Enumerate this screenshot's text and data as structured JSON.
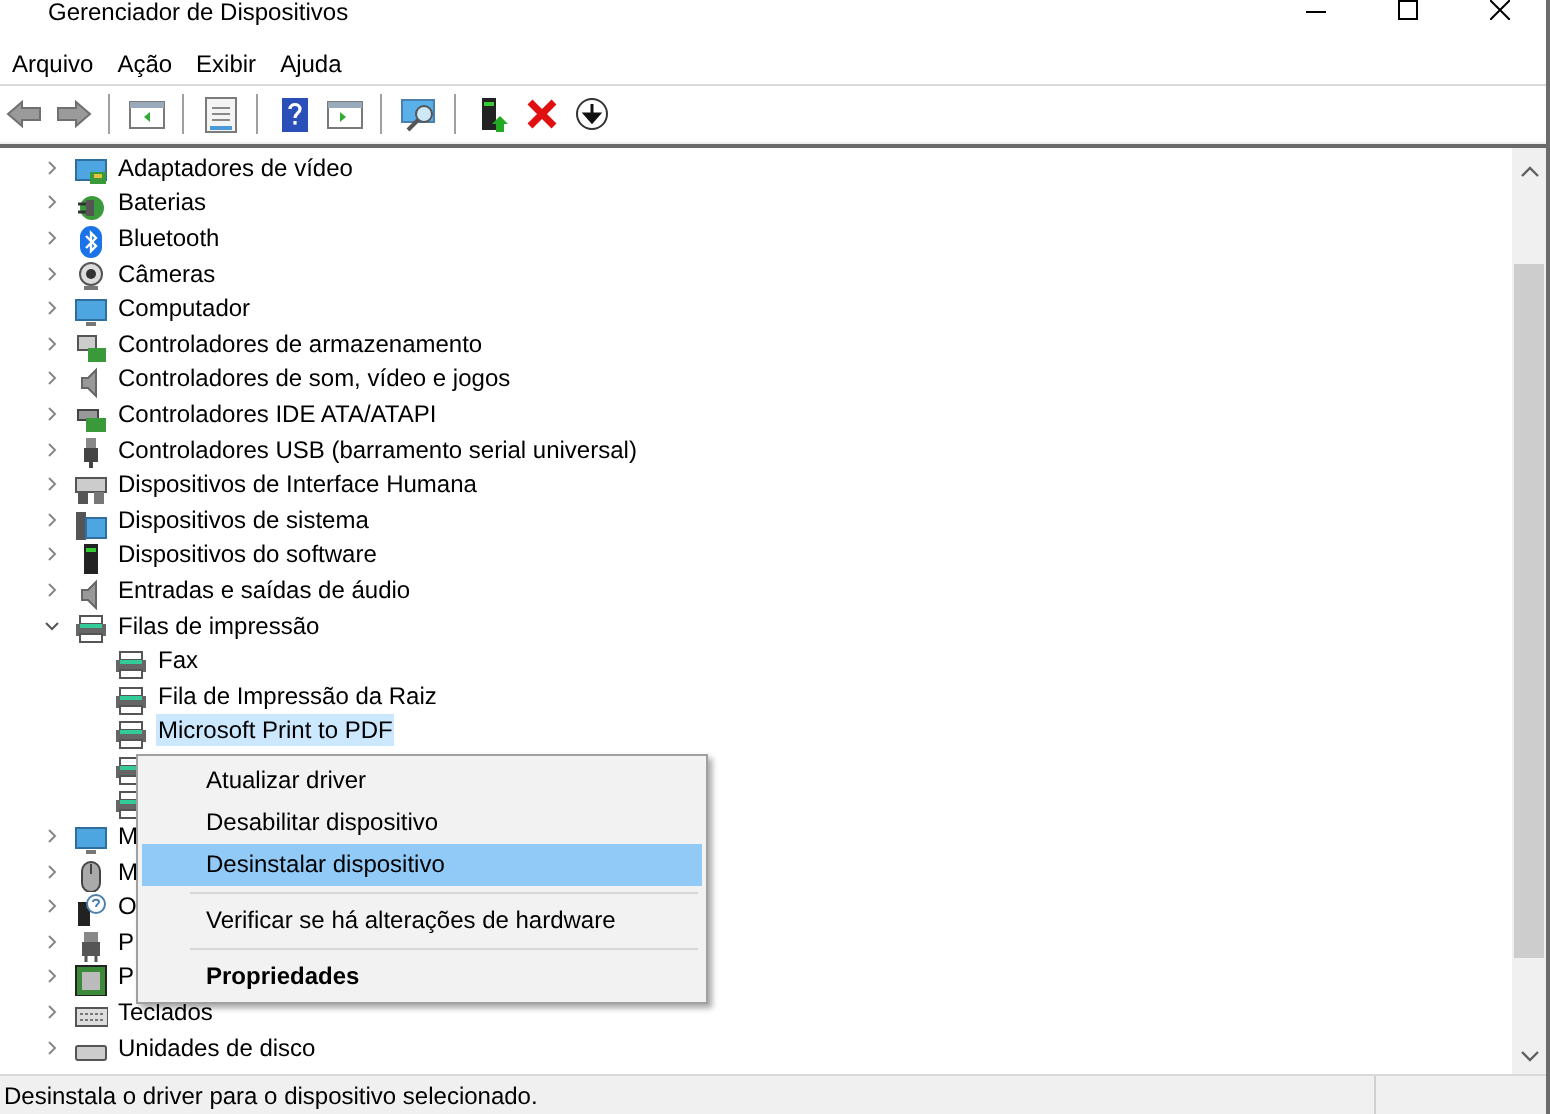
{
  "window": {
    "title": "Gerenciador de Dispositivos"
  },
  "menu": [
    "Arquivo",
    "Ação",
    "Exibir",
    "Ajuda"
  ],
  "toolbar": [
    {
      "kind": "back"
    },
    {
      "kind": "forward"
    },
    {
      "kind": "sep"
    },
    {
      "kind": "panel"
    },
    {
      "kind": "sep"
    },
    {
      "kind": "sheet"
    },
    {
      "kind": "sep"
    },
    {
      "kind": "help"
    },
    {
      "kind": "panel2"
    },
    {
      "kind": "sep"
    },
    {
      "kind": "scan"
    },
    {
      "kind": "sep"
    },
    {
      "kind": "driver"
    },
    {
      "kind": "remove"
    },
    {
      "kind": "down"
    }
  ],
  "tree": [
    {
      "label": "Adaptadores de vídeo",
      "kind": "display",
      "expanded": false,
      "selected": false
    },
    {
      "label": "Baterias",
      "kind": "battery",
      "expanded": false,
      "selected": false
    },
    {
      "label": "Bluetooth",
      "kind": "bluetooth",
      "expanded": false,
      "selected": false
    },
    {
      "label": "Câmeras",
      "kind": "camera",
      "expanded": false,
      "selected": false
    },
    {
      "label": "Computador",
      "kind": "monitor",
      "expanded": false,
      "selected": false
    },
    {
      "label": "Controladores de armazenamento",
      "kind": "storage",
      "expanded": false,
      "selected": false
    },
    {
      "label": "Controladores de som, vídeo e jogos",
      "kind": "sound",
      "expanded": false,
      "selected": false
    },
    {
      "label": "Controladores IDE ATA/ATAPI",
      "kind": "ide",
      "expanded": false,
      "selected": false
    },
    {
      "label": "Controladores USB (barramento serial universal)",
      "kind": "usb",
      "expanded": false,
      "selected": false
    },
    {
      "label": "Dispositivos de Interface Humana",
      "kind": "hid",
      "expanded": false,
      "selected": false
    },
    {
      "label": "Dispositivos de sistema",
      "kind": "system",
      "expanded": false,
      "selected": false
    },
    {
      "label": "Dispositivos do software",
      "kind": "software",
      "expanded": false,
      "selected": false
    },
    {
      "label": "Entradas e saídas de áudio",
      "kind": "sound",
      "expanded": false,
      "selected": false
    },
    {
      "label": "Filas de impressão",
      "kind": "printer",
      "expanded": true,
      "selected": false,
      "children": [
        {
          "label": "Fax",
          "kind": "printer",
          "selected": false
        },
        {
          "label": "Fila de Impressão da Raiz",
          "kind": "printer",
          "selected": false
        },
        {
          "label": "Microsoft Print to PDF",
          "kind": "printer",
          "selected": true
        },
        {
          "kind": "printer"
        },
        {
          "kind": "printer"
        }
      ]
    },
    {
      "label": "M",
      "kind": "monitor",
      "expanded": false,
      "selected": false
    },
    {
      "label": "M",
      "kind": "mouse",
      "expanded": false,
      "selected": false
    },
    {
      "label": "O",
      "kind": "other",
      "expanded": false,
      "selected": false
    },
    {
      "label": "P",
      "kind": "port",
      "expanded": false,
      "selected": false
    },
    {
      "label": "P",
      "kind": "cpu",
      "expanded": false,
      "selected": false
    },
    {
      "label": "Teclados",
      "kind": "keyboard",
      "expanded": false,
      "selected": false
    },
    {
      "label": "Unidades de disco",
      "kind": "disk",
      "expanded": false,
      "selected": false
    }
  ],
  "context_menu": [
    {
      "kind": "item",
      "label": "Atualizar driver",
      "selected": false
    },
    {
      "kind": "item",
      "label": "Desabilitar dispositivo",
      "selected": false
    },
    {
      "kind": "item",
      "label": "Desinstalar dispositivo",
      "selected": true
    },
    {
      "kind": "separator"
    },
    {
      "kind": "item",
      "label": "Verificar se há alterações de hardware",
      "selected": false
    },
    {
      "kind": "separator"
    },
    {
      "kind": "item",
      "label": "Propriedades",
      "selected": false,
      "default": true
    }
  ],
  "status_bar": "Desinstala o driver para o dispositivo selecionado."
}
